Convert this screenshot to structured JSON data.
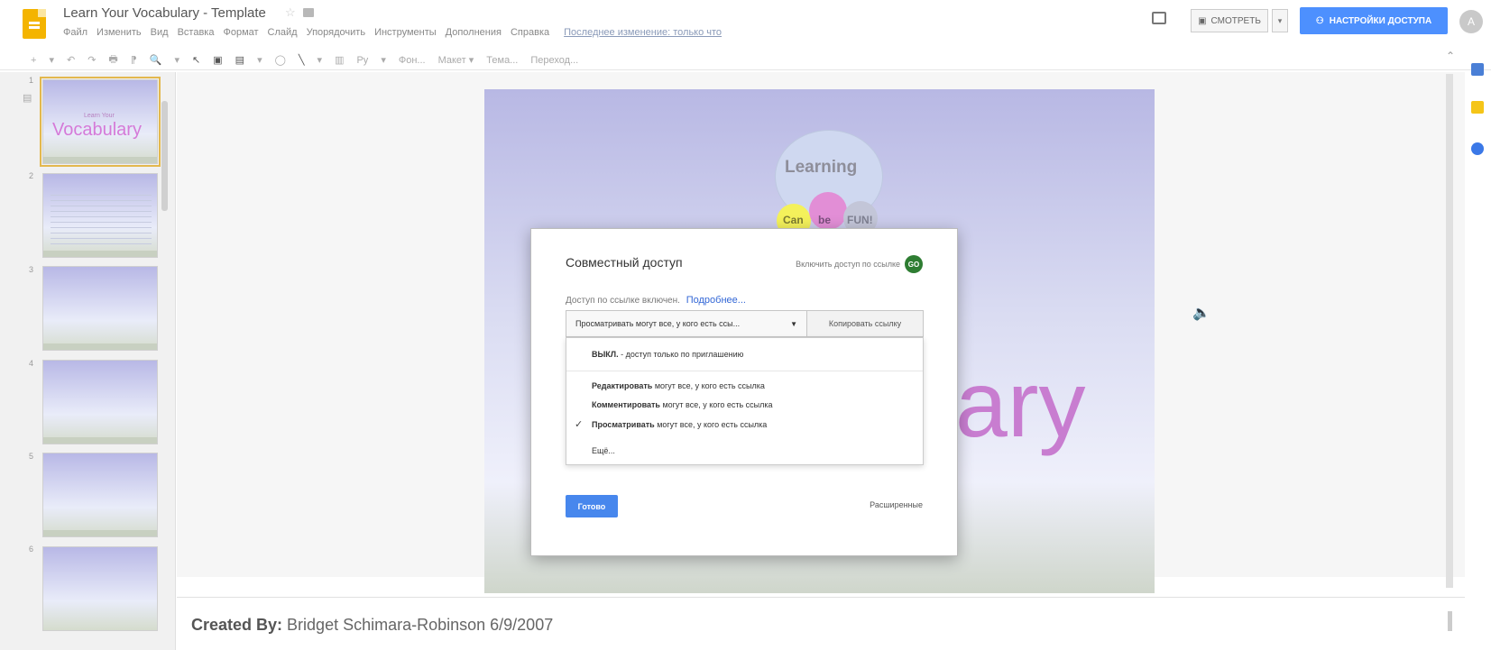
{
  "header": {
    "doc_title": "Learn Your Vocabulary - Template",
    "star_icon": "star-icon",
    "folder_icon": "folder-icon",
    "menus": [
      "Файл",
      "Изменить",
      "Вид",
      "Вставка",
      "Формат",
      "Слайд",
      "Упорядочить",
      "Инструменты",
      "Дополнения",
      "Справка"
    ],
    "last_edit": "Последнее изменение: только что",
    "present_label": "СМОТРЕТЬ",
    "present_arrow": "▾",
    "share_label": "НАСТРОЙКИ ДОСТУПА",
    "avatar_initial": "A",
    "share_color": "#4d90fe"
  },
  "toolbar": {
    "items": [
      "+",
      "▾",
      "↶",
      "↷",
      "🖶",
      "⁋",
      "🔍",
      "▾",
      "↖",
      "▣",
      "▤",
      "▾",
      "◯",
      "╲",
      "▾",
      "▥",
      "Ру",
      "▾",
      "Фон...",
      "Макет ▾",
      "Тема...",
      "Переход..."
    ],
    "collapse": "⌃"
  },
  "filmstrip": {
    "slide_numbers": [
      "1",
      "2",
      "3",
      "4",
      "5",
      "6"
    ],
    "slide1_small": "Learn Your",
    "slide1_big": "Vocabulary"
  },
  "slide": {
    "learning": "Learning",
    "can": "Can",
    "be": "be",
    "fun": "FUN!",
    "ary": "ary"
  },
  "notes": {
    "label": "Created By:",
    "text": "Bridget Schimara-Robinson 6/9/2007"
  },
  "dialog": {
    "title": "Совместный доступ",
    "link_toggle": "Включить доступ по ссылке",
    "go_label": "GO",
    "access_status": "Доступ по ссылке включен.",
    "more_link": "Подробнее...",
    "selected_permission": "Просматривать могут все, у кого есть ссы...",
    "dropdown_arrow": "▼",
    "copy_link": "Копировать ссылку",
    "options": [
      {
        "bold": "ВЫКЛ.",
        "text": " - доступ только по приглашению"
      },
      {
        "bold": "Редактировать",
        "text": " могут все, у кого есть ссылка"
      },
      {
        "bold": "Комментировать",
        "text": " могут все, у кого есть ссылка"
      },
      {
        "bold": "Просматривать",
        "text": " могут все, у кого есть ссылка"
      }
    ],
    "check": "✓",
    "more_options": "Ещё...",
    "done": "Готово",
    "advanced": "Расширенные",
    "done_color": "#4787ed"
  }
}
